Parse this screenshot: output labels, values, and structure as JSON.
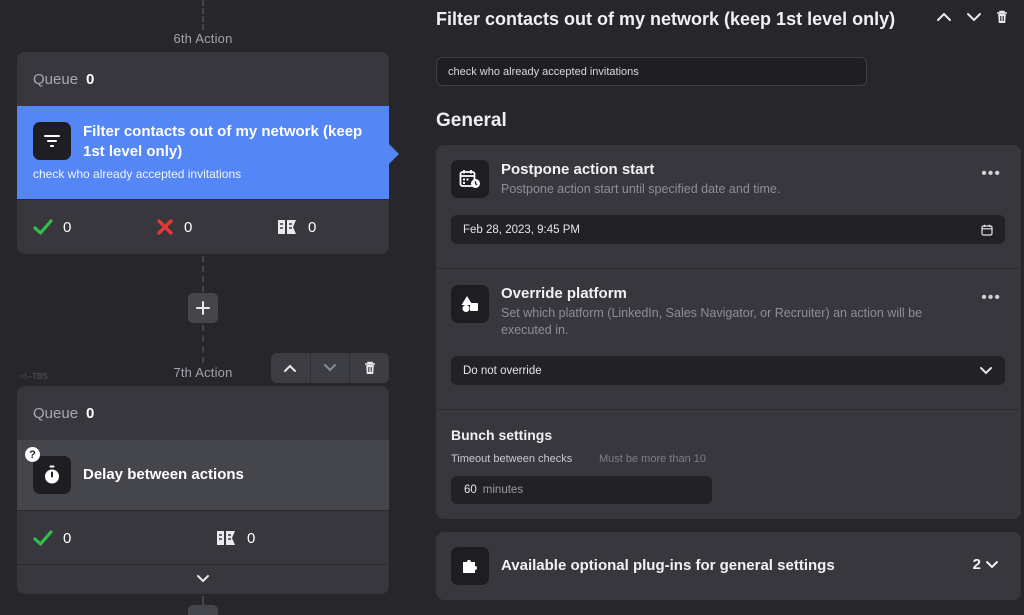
{
  "flow": {
    "action6": {
      "label": "6th Action",
      "queue_label": "Queue",
      "queue_count": "0",
      "title": "Filter contacts out of my network (keep 1st level only)",
      "subtitle": "check who already accepted invitations",
      "success_count": "0",
      "failed_count": "0",
      "skipped_count": "0"
    },
    "action7": {
      "label": "7th Action",
      "queue_label": "Queue",
      "queue_count": "0",
      "title": "Delay between actions",
      "help_badge": "?",
      "success_count": "0",
      "skipped_count": "0"
    },
    "faint_text": "<!--TBS"
  },
  "details": {
    "title": "Filter contacts out of my network (keep 1st level only)",
    "note_value": "check who already accepted invitations",
    "section_heading": "General",
    "postpone": {
      "title": "Postpone action start",
      "description": "Postpone action start until specified date and time.",
      "date_value": "Feb 28, 2023, 9:45 PM"
    },
    "override": {
      "title": "Override platform",
      "description": "Set which platform (LinkedIn, Sales Navigator, or Recruiter) an action will be executed in.",
      "selected": "Do not override"
    },
    "bunch": {
      "title": "Bunch settings",
      "timeout_label": "Timeout between checks",
      "timeout_hint": "Must be more than 10",
      "timeout_value": "60",
      "timeout_unit": "minutes"
    },
    "plugins": {
      "title": "Available optional plug-ins for general settings",
      "count": "2"
    }
  },
  "colors": {
    "accent": "#5586f5",
    "success": "#2fbf4a",
    "danger": "#e53935",
    "background": "#26262b",
    "card": "#37373d"
  }
}
